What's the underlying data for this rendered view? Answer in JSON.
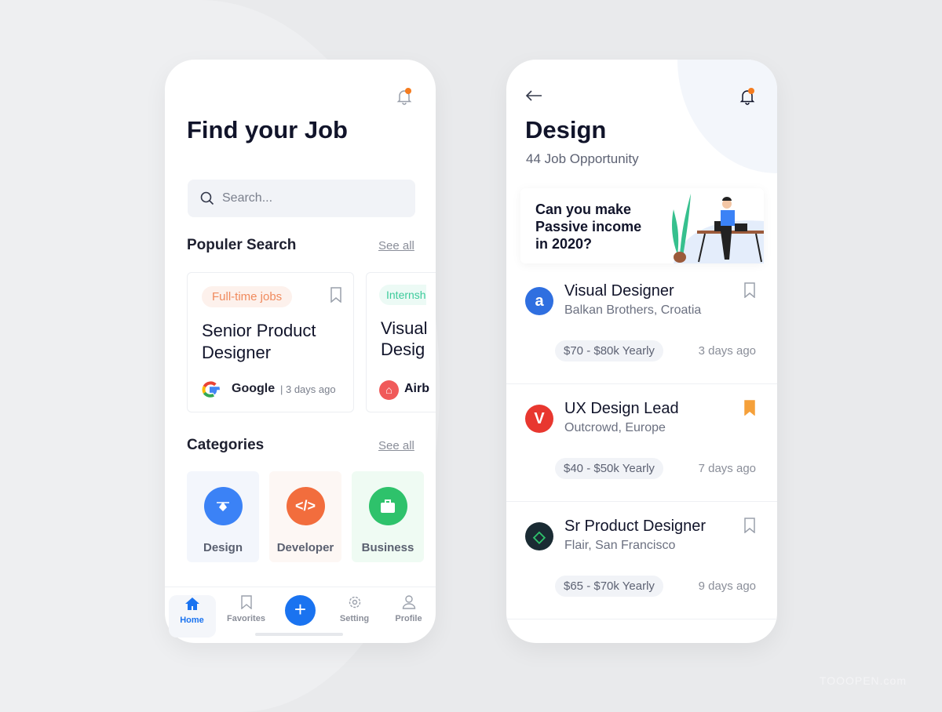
{
  "screen1": {
    "title": "Find your Job",
    "search_placeholder": "Search...",
    "popular": {
      "title": "Populer Search",
      "see_all": "See all",
      "cards": [
        {
          "tag": "Full-time jobs",
          "title_line1": "Senior Product",
          "title_line2": "Designer",
          "company": "Google",
          "time": "| 3 days ago"
        },
        {
          "tag": "Internsh",
          "title_line1": "Visual",
          "title_line2": "Desig",
          "company": "Airb"
        }
      ]
    },
    "categories": {
      "title": "Categories",
      "see_all": "See all",
      "items": [
        {
          "label": "Design",
          "color": "#3b82f6"
        },
        {
          "label": "Developer",
          "color": "#f26d3d"
        },
        {
          "label": "Business",
          "color": "#2ec26b"
        }
      ]
    },
    "nav": [
      {
        "label": "Home"
      },
      {
        "label": "Favorites"
      },
      {
        "label": "+"
      },
      {
        "label": "Setting"
      },
      {
        "label": "Profile"
      }
    ]
  },
  "screen2": {
    "title": "Design",
    "subtitle": "44 Job Opportunity",
    "banner": {
      "line1": "Can you make",
      "line2": "Passive income",
      "line3": "in 2020?"
    },
    "jobs": [
      {
        "title": "Visual Designer",
        "company": "Balkan Brothers, Croatia",
        "salary": "$70 - $80k Yearly",
        "ago": "3 days ago",
        "saved": false
      },
      {
        "title": "UX Design Lead",
        "company": "Outcrowd, Europe",
        "salary": "$40 - $50k Yearly",
        "ago": "7 days ago",
        "saved": true
      },
      {
        "title": "Sr Product Designer",
        "company": "Flair, San Francisco",
        "salary": "$65 - $70k Yearly",
        "ago": "9 days ago",
        "saved": false
      }
    ]
  },
  "colors": {
    "accent": "#1a73f0",
    "notification": "#f57c1f",
    "bookmark_active": "#f5a03a"
  },
  "watermark": "TOOOPEN.com"
}
